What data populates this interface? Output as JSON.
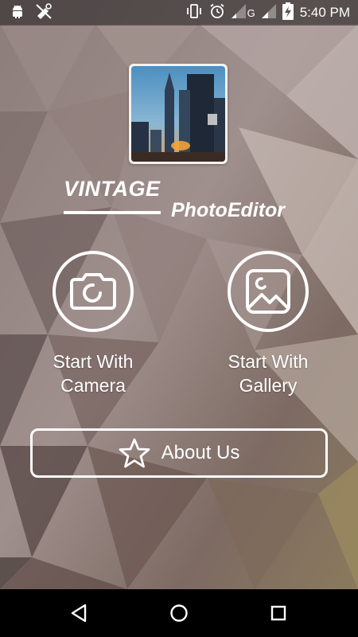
{
  "status_bar": {
    "time": "5:40 PM",
    "network_label": "G"
  },
  "brand": {
    "line1": "VINTAGE",
    "line2": "PhotoEditor"
  },
  "actions": {
    "camera": {
      "line1": "Start With",
      "line2": "Camera",
      "icon": "camera-icon"
    },
    "gallery": {
      "line1": "Start With",
      "line2": "Gallery",
      "icon": "image-icon"
    }
  },
  "about": {
    "label": "About Us",
    "icon": "star-icon"
  },
  "nav": {
    "back_icon": "back-triangle-icon",
    "home_icon": "home-circle-icon",
    "recents_icon": "recents-square-icon"
  },
  "colors": {
    "foreground": "#ffffff",
    "nav_background": "#000000"
  }
}
